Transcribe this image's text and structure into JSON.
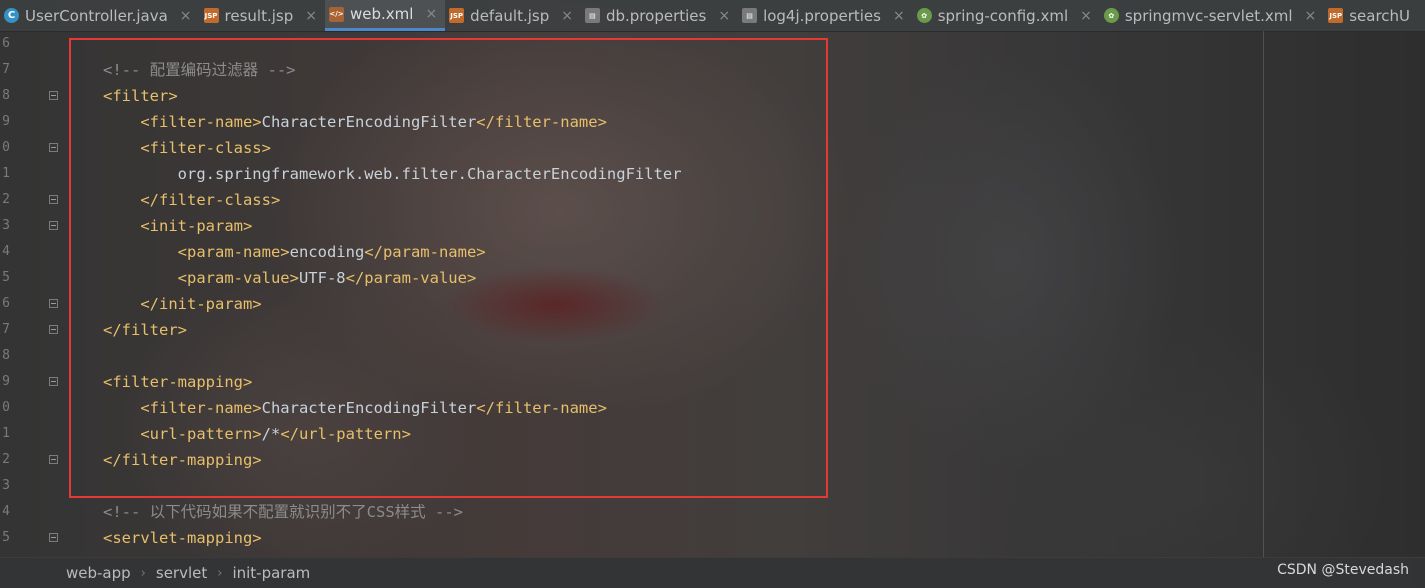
{
  "tabs": [
    {
      "label": "UserController.java",
      "icon": "java-class-icon",
      "badge": "C",
      "kind": "java",
      "active": false
    },
    {
      "label": "result.jsp",
      "icon": "jsp-file-icon",
      "badge": "JSP",
      "kind": "jsp",
      "active": false
    },
    {
      "label": "web.xml",
      "icon": "xml-file-icon",
      "badge": "</>",
      "kind": "xml",
      "active": true
    },
    {
      "label": "default.jsp",
      "icon": "jsp-file-icon",
      "badge": "JSP",
      "kind": "jsp",
      "active": false
    },
    {
      "label": "db.properties",
      "icon": "properties-file-icon",
      "badge": "▤",
      "kind": "props",
      "active": false
    },
    {
      "label": "log4j.properties",
      "icon": "properties-file-icon",
      "badge": "▤",
      "kind": "props",
      "active": false
    },
    {
      "label": "spring-config.xml",
      "icon": "spring-xml-icon",
      "badge": "✿",
      "kind": "spring",
      "active": false
    },
    {
      "label": "springmvc-servlet.xml",
      "icon": "spring-xml-icon",
      "badge": "✿",
      "kind": "spring",
      "active": false
    },
    {
      "label": "searchU",
      "icon": "jsp-file-icon",
      "badge": "JSP",
      "kind": "jsp",
      "active": false
    }
  ],
  "close_glyph": "×",
  "line_numbers": [
    "6",
    "7",
    "8",
    "9",
    "0",
    "1",
    "2",
    "3",
    "4",
    "5",
    "6",
    "7",
    "8",
    "9",
    "0",
    "1",
    "2",
    "3",
    "4",
    "5"
  ],
  "code_lines": [
    {
      "parts": []
    },
    {
      "parts": [
        {
          "c": "cmt",
          "t": "<!-- 配置编码过滤器 -->"
        }
      ]
    },
    {
      "parts": [
        {
          "c": "tag",
          "t": "<filter>"
        }
      ]
    },
    {
      "parts": [
        {
          "c": "tag",
          "t": "    <filter-name>"
        },
        {
          "c": "txt",
          "t": "CharacterEncodingFilter"
        },
        {
          "c": "tag",
          "t": "</filter-name>"
        }
      ]
    },
    {
      "parts": [
        {
          "c": "tag",
          "t": "    <filter-class>"
        }
      ]
    },
    {
      "parts": [
        {
          "c": "txt",
          "t": "        org.springframework.web.filter.CharacterEncodingFilter"
        }
      ]
    },
    {
      "parts": [
        {
          "c": "tag",
          "t": "    </filter-class>"
        }
      ]
    },
    {
      "parts": [
        {
          "c": "tag",
          "t": "    <init-param>"
        }
      ]
    },
    {
      "parts": [
        {
          "c": "tag",
          "t": "        <param-name>"
        },
        {
          "c": "txt",
          "t": "encoding"
        },
        {
          "c": "tag",
          "t": "</param-name>"
        }
      ]
    },
    {
      "parts": [
        {
          "c": "tag",
          "t": "        <param-value>"
        },
        {
          "c": "txt",
          "t": "UTF-8"
        },
        {
          "c": "tag",
          "t": "</param-value>"
        }
      ]
    },
    {
      "parts": [
        {
          "c": "tag",
          "t": "    </init-param>"
        }
      ]
    },
    {
      "parts": [
        {
          "c": "tag",
          "t": "</filter>"
        }
      ]
    },
    {
      "parts": []
    },
    {
      "parts": [
        {
          "c": "tag",
          "t": "<filter-mapping>"
        }
      ]
    },
    {
      "parts": [
        {
          "c": "tag",
          "t": "    <filter-name>"
        },
        {
          "c": "txt",
          "t": "CharacterEncodingFilter"
        },
        {
          "c": "tag",
          "t": "</filter-name>"
        }
      ]
    },
    {
      "parts": [
        {
          "c": "tag",
          "t": "    <url-pattern>"
        },
        {
          "c": "txt",
          "t": "/*"
        },
        {
          "c": "tag",
          "t": "</url-pattern>"
        }
      ]
    },
    {
      "parts": [
        {
          "c": "tag",
          "t": "</filter-mapping>"
        }
      ]
    },
    {
      "parts": []
    },
    {
      "parts": [
        {
          "c": "cmt",
          "t": "<!-- 以下代码如果不配置就识别不了CSS样式 -->"
        }
      ]
    },
    {
      "parts": [
        {
          "c": "tag",
          "t": "<servlet-mapping>"
        }
      ]
    }
  ],
  "fold_lines": [
    2,
    4,
    6,
    7,
    10,
    11,
    13,
    16,
    19
  ],
  "breadcrumb": [
    "web-app",
    "servlet",
    "init-param"
  ],
  "breadcrumb_sep": "›",
  "watermark": "CSDN @Stevedash",
  "colors": {
    "tag": "#e8bf6a",
    "text": "#c9d1d9",
    "comment": "#8c8c8c",
    "highlight": "#e53935",
    "active_tab_underline": "#4a88c7"
  }
}
